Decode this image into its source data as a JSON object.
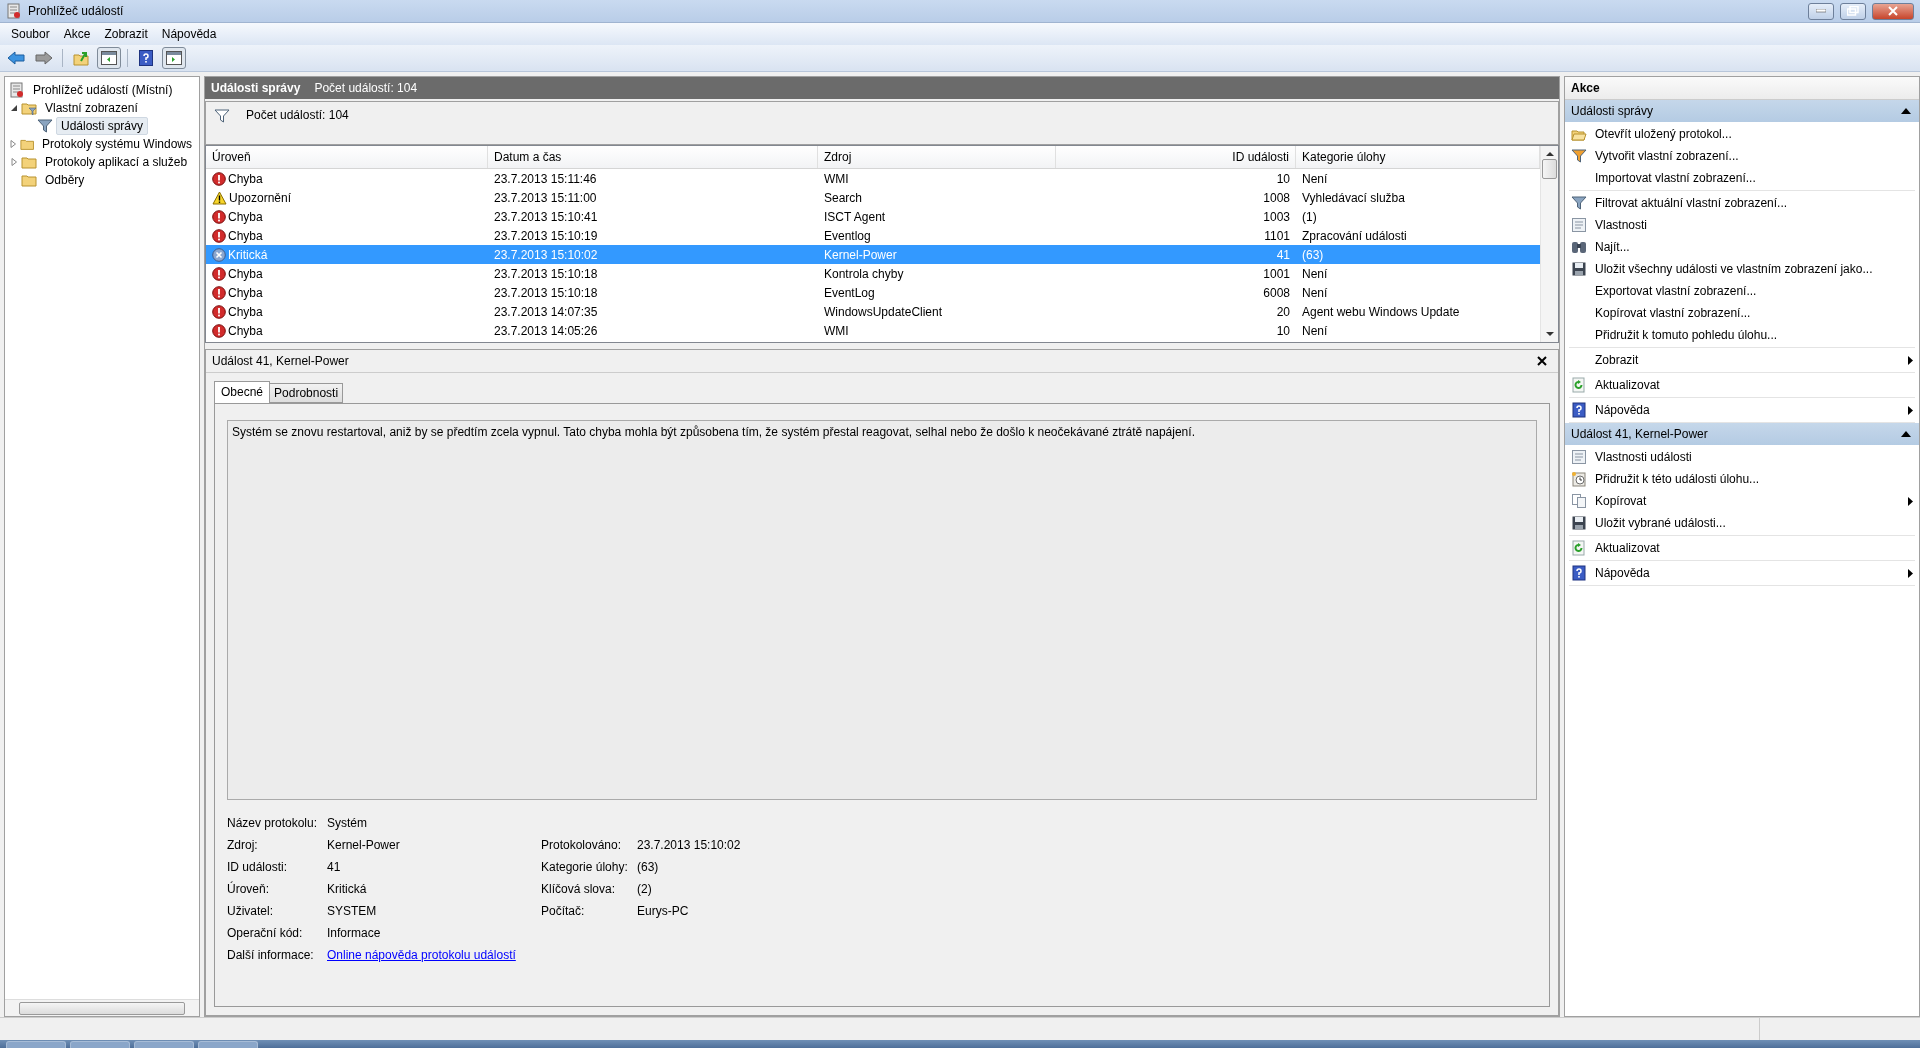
{
  "window": {
    "title": "Prohlížeč událostí"
  },
  "menu": [
    {
      "label": "Soubor"
    },
    {
      "label": "Akce"
    },
    {
      "label": "Zobrazit"
    },
    {
      "label": "Nápověda"
    }
  ],
  "tree": [
    {
      "label": "Prohlížeč událostí (Místní)",
      "selected": false,
      "children": [
        {
          "label": "Vlastní zobrazení",
          "expanded": true,
          "selected": false,
          "children": [
            {
              "label": "Události správy",
              "selected": true
            }
          ]
        },
        {
          "label": "Protokoly systému Windows",
          "expanded": false,
          "selected": false
        },
        {
          "label": "Protokoly aplikací a služeb",
          "expanded": false,
          "selected": false
        },
        {
          "label": "Odběry",
          "selected": false
        }
      ]
    }
  ],
  "view_header": {
    "title": "Události správy",
    "count": "Počet událostí: 104"
  },
  "filter": {
    "text": "Počet událostí: 104"
  },
  "table": {
    "columns": [
      "Úroveň",
      "Datum a čas",
      "Zdroj",
      "ID události",
      "Kategorie úlohy"
    ],
    "rows": [
      {
        "kind": "error",
        "level": "Chyba",
        "date": "23.7.2013 15:11:46",
        "source": "WMI",
        "id": "10",
        "category": "Není",
        "selected": false
      },
      {
        "kind": "warning",
        "level": "Upozornění",
        "date": "23.7.2013 15:11:00",
        "source": "Search",
        "id": "1008",
        "category": "Vyhledávací služba",
        "selected": false
      },
      {
        "kind": "error",
        "level": "Chyba",
        "date": "23.7.2013 15:10:41",
        "source": "ISCT Agent",
        "id": "1003",
        "category": "(1)",
        "selected": false
      },
      {
        "kind": "error",
        "level": "Chyba",
        "date": "23.7.2013 15:10:19",
        "source": "Eventlog",
        "id": "1101",
        "category": "Zpracování události",
        "selected": false
      },
      {
        "kind": "critical",
        "level": "Kritická",
        "date": "23.7.2013 15:10:02",
        "source": "Kernel-Power",
        "id": "41",
        "category": "(63)",
        "selected": true
      },
      {
        "kind": "error",
        "level": "Chyba",
        "date": "23.7.2013 15:10:18",
        "source": "Kontrola chyby",
        "id": "1001",
        "category": "Není",
        "selected": false
      },
      {
        "kind": "error",
        "level": "Chyba",
        "date": "23.7.2013 15:10:18",
        "source": "EventLog",
        "id": "6008",
        "category": "Není",
        "selected": false
      },
      {
        "kind": "error",
        "level": "Chyba",
        "date": "23.7.2013 14:07:35",
        "source": "WindowsUpdateClient",
        "id": "20",
        "category": "Agent webu Windows Update",
        "selected": false
      },
      {
        "kind": "error",
        "level": "Chyba",
        "date": "23.7.2013 14:05:26",
        "source": "WMI",
        "id": "10",
        "category": "Není",
        "selected": false
      }
    ]
  },
  "details": {
    "title": "Událost 41, Kernel-Power",
    "tabs": [
      {
        "label": "Obecné",
        "selected": true
      },
      {
        "label": "Podrobnosti",
        "selected": false
      }
    ],
    "description": "Systém se znovu restartoval, aniž by se předtím zcela vypnul. Tato chyba mohla být způsobena tím, že systém přestal reagovat, selhal nebo že došlo k neočekávané ztrátě napájení.",
    "rows": [
      {
        "left": {
          "label": "Název protokolu:",
          "value": "Systém"
        }
      },
      {
        "left": {
          "label": "Zdroj:",
          "value": "Kernel-Power"
        },
        "right": {
          "label": "Protokolováno:",
          "value": "23.7.2013 15:10:02"
        }
      },
      {
        "left": {
          "label": "ID události:",
          "value": "41"
        },
        "right": {
          "label": "Kategorie úlohy:",
          "value": "(63)"
        }
      },
      {
        "left": {
          "label": "Úroveň:",
          "value": "Kritická"
        },
        "right": {
          "label": "Klíčová slova:",
          "value": "(2)"
        }
      },
      {
        "left": {
          "label": "Uživatel:",
          "value": "SYSTEM"
        },
        "right": {
          "label": "Počítač:",
          "value": "Eurys-PC"
        }
      },
      {
        "left": {
          "label": "Operační kód:",
          "value": "Informace"
        }
      }
    ],
    "more_info": {
      "label": "Další informace:",
      "link": "Online nápověda protokolu událostí"
    }
  },
  "actions": {
    "title": "Akce",
    "sections": [
      {
        "title": "Události správy",
        "expanded": true,
        "groups": [
          [
            {
              "label": "Otevřít uložený protokol...",
              "submenu": false
            },
            {
              "label": "Vytvořit vlastní zobrazení...",
              "submenu": false
            },
            {
              "label": "Importovat vlastní zobrazení...",
              "submenu": false
            }
          ],
          [
            {
              "label": "Filtrovat aktuální vlastní zobrazení...",
              "submenu": false
            },
            {
              "label": "Vlastnosti",
              "submenu": false
            },
            {
              "label": "Najít...",
              "submenu": false
            },
            {
              "label": "Uložit všechny události ve vlastním zobrazení jako...",
              "submenu": false
            },
            {
              "label": "Exportovat vlastní zobrazení...",
              "submenu": false
            },
            {
              "label": "Kopírovat vlastní zobrazení...",
              "submenu": false
            },
            {
              "label": "Přidružit k tomuto pohledu úlohu...",
              "submenu": false
            }
          ],
          [
            {
              "label": "Zobrazit",
              "submenu": true
            }
          ],
          [
            {
              "label": "Aktualizovat",
              "submenu": false
            }
          ],
          [
            {
              "label": "Nápověda",
              "submenu": true
            }
          ]
        ]
      },
      {
        "title": "Událost 41, Kernel-Power",
        "expanded": true,
        "groups": [
          [
            {
              "label": "Vlastnosti události",
              "submenu": false
            },
            {
              "label": "Přidružit k této události úlohu...",
              "submenu": false
            },
            {
              "label": "Kopírovat",
              "submenu": true
            },
            {
              "label": "Uložit vybrané události...",
              "submenu": false
            }
          ],
          [
            {
              "label": "Aktualizovat",
              "submenu": false
            }
          ],
          [
            {
              "label": "Nápověda",
              "submenu": true
            }
          ]
        ]
      }
    ]
  }
}
